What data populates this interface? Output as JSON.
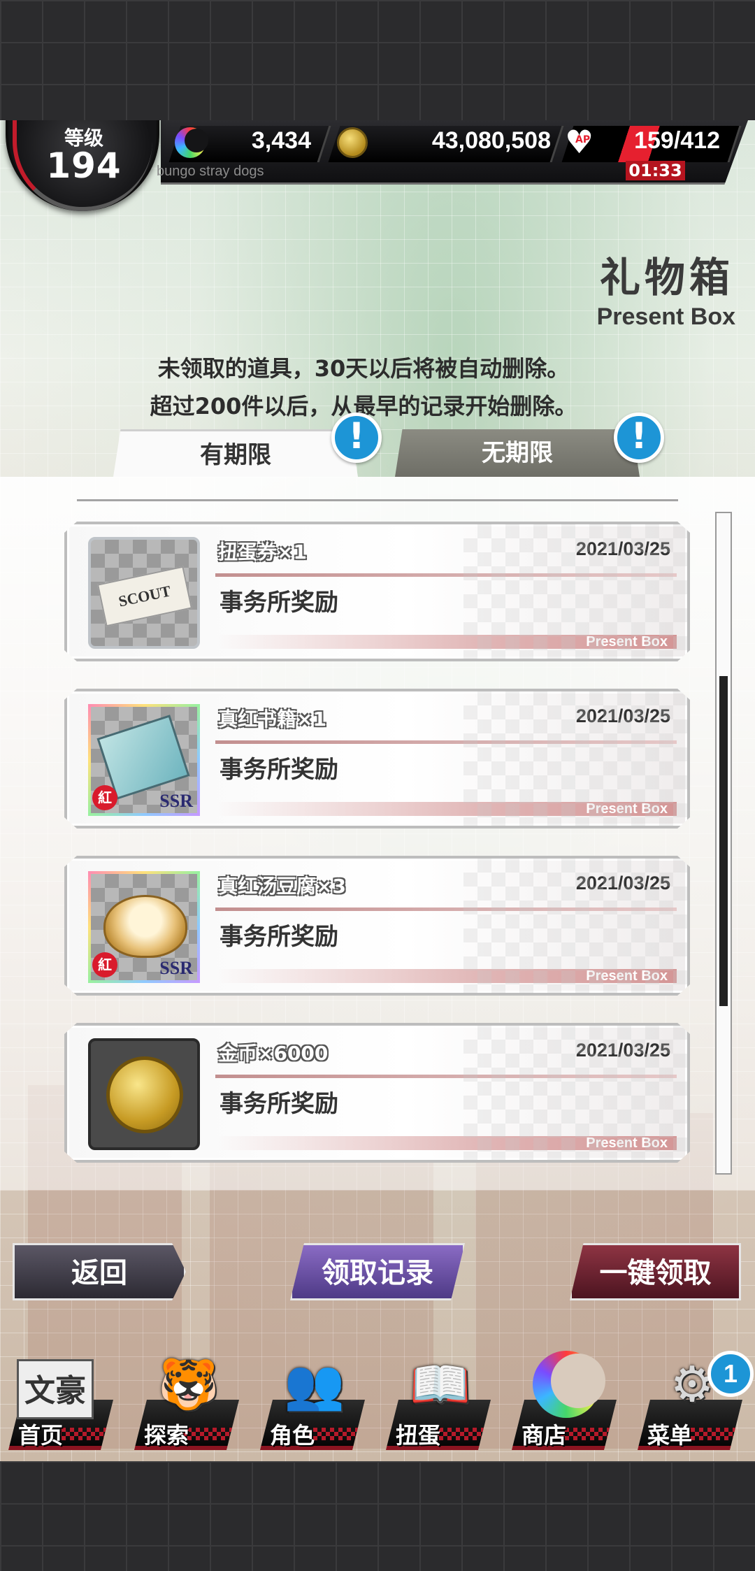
{
  "status": {
    "level_label": "等级",
    "level": "194",
    "game_subtitle": "bungo stray dogs",
    "gems": "3,434",
    "coins": "43,080,508",
    "stamina": "159/412",
    "stamina_timer": "01:33",
    "ap_tag": "AP",
    "accent_color": "#e6202f"
  },
  "header": {
    "title": "礼物箱",
    "title_en": "Present Box",
    "notice_line1": "未领取的道具，30天以后将被自动删除。",
    "notice_line2": "超过200件以后，从最早的记录开始删除。"
  },
  "tabs": [
    {
      "label": "有期限",
      "selected": true,
      "alert": "!"
    },
    {
      "label": "无期限",
      "selected": false,
      "alert": "!"
    }
  ],
  "items": [
    {
      "name": "扭蛋券×1",
      "date": "2021/03/25",
      "desc": "事务所奖励",
      "footer": "Present Box",
      "icon": "scout-ticket-icon",
      "art_text": "SCOUT"
    },
    {
      "name": "真红书籍×1",
      "date": "2021/03/25",
      "desc": "事务所奖励",
      "footer": "Present Box",
      "icon": "book-icon",
      "rarity": "SSR",
      "badge": "紅"
    },
    {
      "name": "真红汤豆腐×3",
      "date": "2021/03/25",
      "desc": "事务所奖励",
      "footer": "Present Box",
      "icon": "tofu-pot-icon",
      "rarity": "SSR",
      "badge": "紅"
    },
    {
      "name": "金币×6000",
      "date": "2021/03/25",
      "desc": "事务所奖励",
      "footer": "Present Box",
      "icon": "gold-coin-icon"
    }
  ],
  "actions": {
    "back": "返回",
    "records": "领取记录",
    "claim_all": "一键领取"
  },
  "nav": [
    {
      "label": "首页",
      "icon": "home-icon",
      "art": "文豪"
    },
    {
      "label": "探索",
      "icon": "tiger-icon",
      "art": "🐯"
    },
    {
      "label": "角色",
      "icon": "characters-icon",
      "art": "👥"
    },
    {
      "label": "扭蛋",
      "icon": "gacha-icon",
      "art": "📖"
    },
    {
      "label": "商店",
      "icon": "shop-icon"
    },
    {
      "label": "菜单",
      "icon": "gear-icon",
      "art": "⚙",
      "badge": "1"
    }
  ]
}
